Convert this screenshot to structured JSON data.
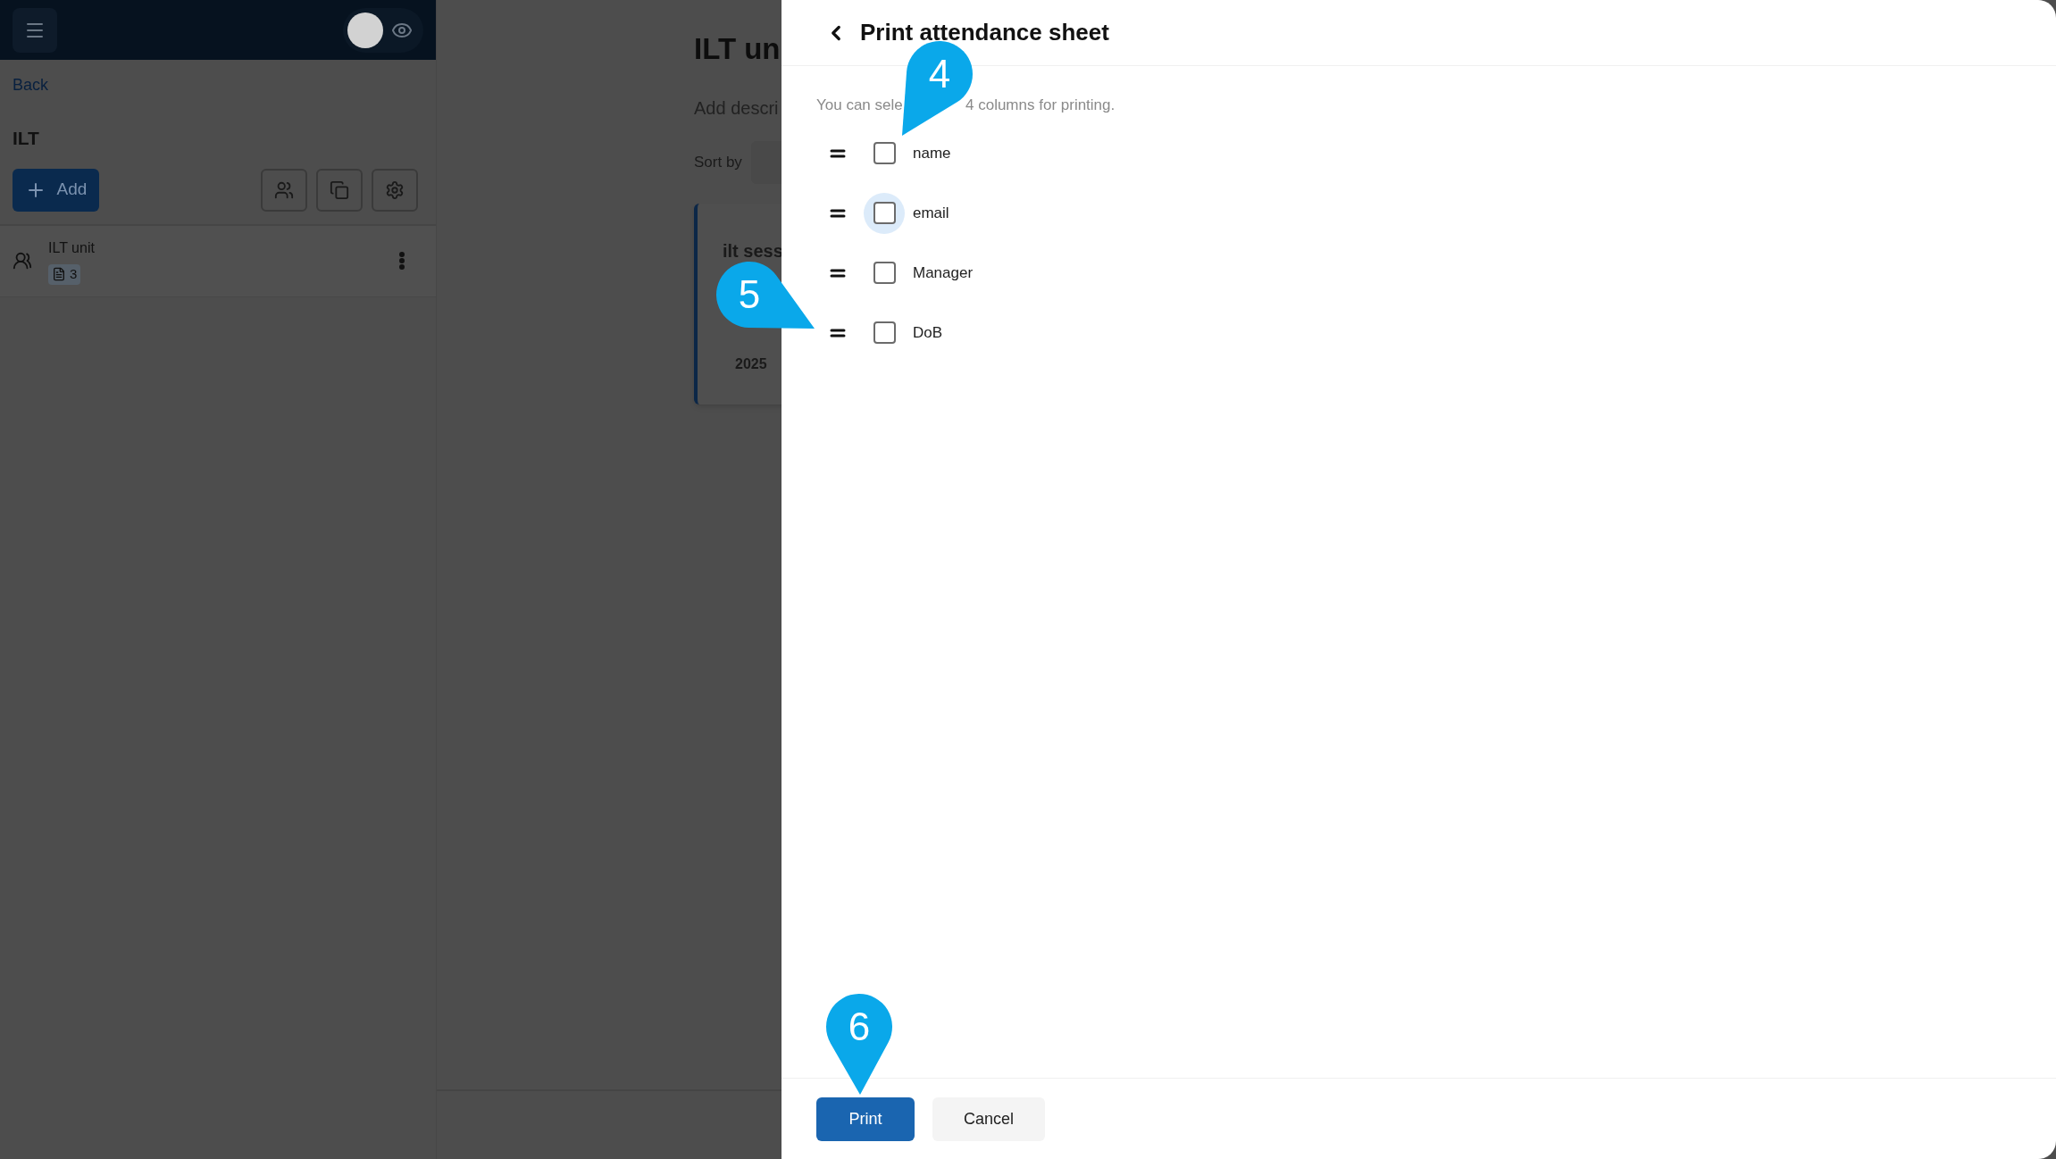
{
  "header": {
    "visibility_toggle": {
      "on": false
    }
  },
  "sidebar": {
    "back_link": "Back",
    "title": "ILT",
    "add_button": "Add",
    "items": [
      {
        "name": "ILT unit",
        "count": "3"
      }
    ]
  },
  "page": {
    "title": "ILT un",
    "description": "Add descri",
    "sort_label": "Sort by",
    "card": {
      "title": "ilt sess",
      "year": "2025"
    }
  },
  "panel": {
    "title": "Print attendance sheet",
    "hint_start": "You can sele",
    "hint_end": "4 columns for printing.",
    "columns": [
      {
        "label": "name",
        "checked": false,
        "focused": false
      },
      {
        "label": "email",
        "checked": false,
        "focused": true
      },
      {
        "label": "Manager",
        "checked": false,
        "focused": false
      },
      {
        "label": "DoB",
        "checked": false,
        "focused": false
      }
    ],
    "buttons": [
      {
        "label": "Print",
        "kind": "primary"
      },
      {
        "label": "Cancel",
        "kind": "secondary"
      }
    ]
  },
  "callouts": [
    {
      "label": "4"
    },
    {
      "label": "5"
    },
    {
      "label": "6"
    }
  ]
}
